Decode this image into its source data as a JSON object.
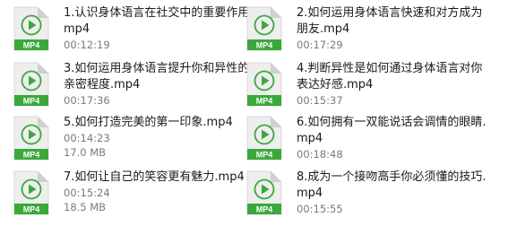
{
  "icon": {
    "name": "mp4-video-file-icon",
    "badge_text": "MP4",
    "accent_color": "#3aa93a",
    "page_color": "#eeeeee"
  },
  "files": [
    {
      "name": "1.认识身体语言在社交中的重要作用.mp4",
      "duration": "00:12:19",
      "size": ""
    },
    {
      "name": "2.如何运用身体语言快速和对方成为朋友.mp4",
      "duration": "00:17:29",
      "size": ""
    },
    {
      "name": "3.如何运用身体语言提升你和异性的亲密程度.mp4",
      "duration": "00:17:36",
      "size": ""
    },
    {
      "name": "4.判断异性是如何通过身体语言对你表达好感.mp4",
      "duration": "00:15:37",
      "size": ""
    },
    {
      "name": "5.如何打造完美的第一印象.mp4",
      "duration": "00:14:23",
      "size": "17.0 MB"
    },
    {
      "name": "6.如何拥有一双能说话会调情的眼睛.mp4",
      "duration": "00:18:48",
      "size": ""
    },
    {
      "name": "7.如何让自己的笑容更有魅力.mp4",
      "duration": "00:15:24",
      "size": "18.5 MB"
    },
    {
      "name": "8.成为一个接吻高手你必须懂的技巧.mp4",
      "duration": "00:15:55",
      "size": ""
    }
  ]
}
